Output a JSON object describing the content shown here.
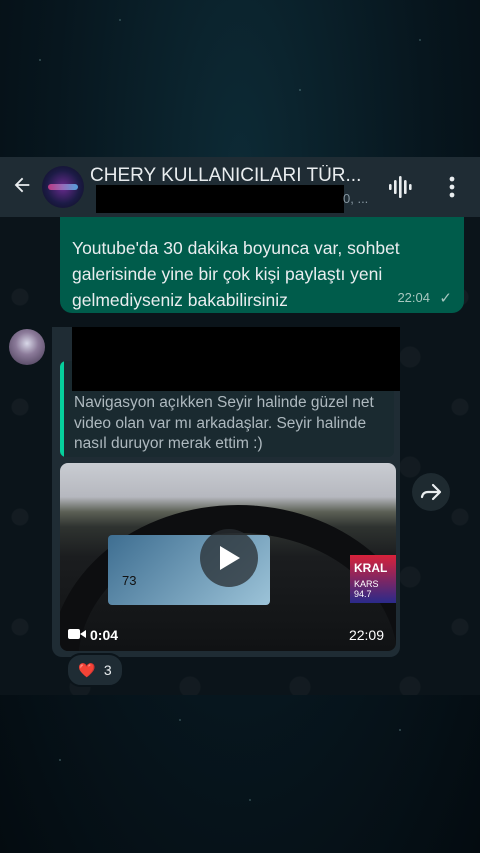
{
  "header": {
    "title": "CHERY KULLANICILARI TÜR...",
    "subtitle_suffix": "0, ..."
  },
  "messages": {
    "outgoing": {
      "text": "Youtube'da 30 dakika boyunca var, sohbet galerisinde yine bir çok kişi paylaştı yeni gelmediyseniz bakabilirsiniz",
      "time": "22:04"
    },
    "incoming": {
      "quoted_text": "Navigasyon açıkken Seyir halinde güzel net video olan var mı arkadaşlar. Seyir halinde nasıl duruyor merak ettim :)",
      "video": {
        "duration": "0:04",
        "time": "22:09",
        "dash_speed": "73",
        "radio_brand": "KRAL",
        "radio_station": "KARS 94.7"
      },
      "reaction": {
        "emoji": "❤️",
        "count": "3"
      }
    }
  }
}
